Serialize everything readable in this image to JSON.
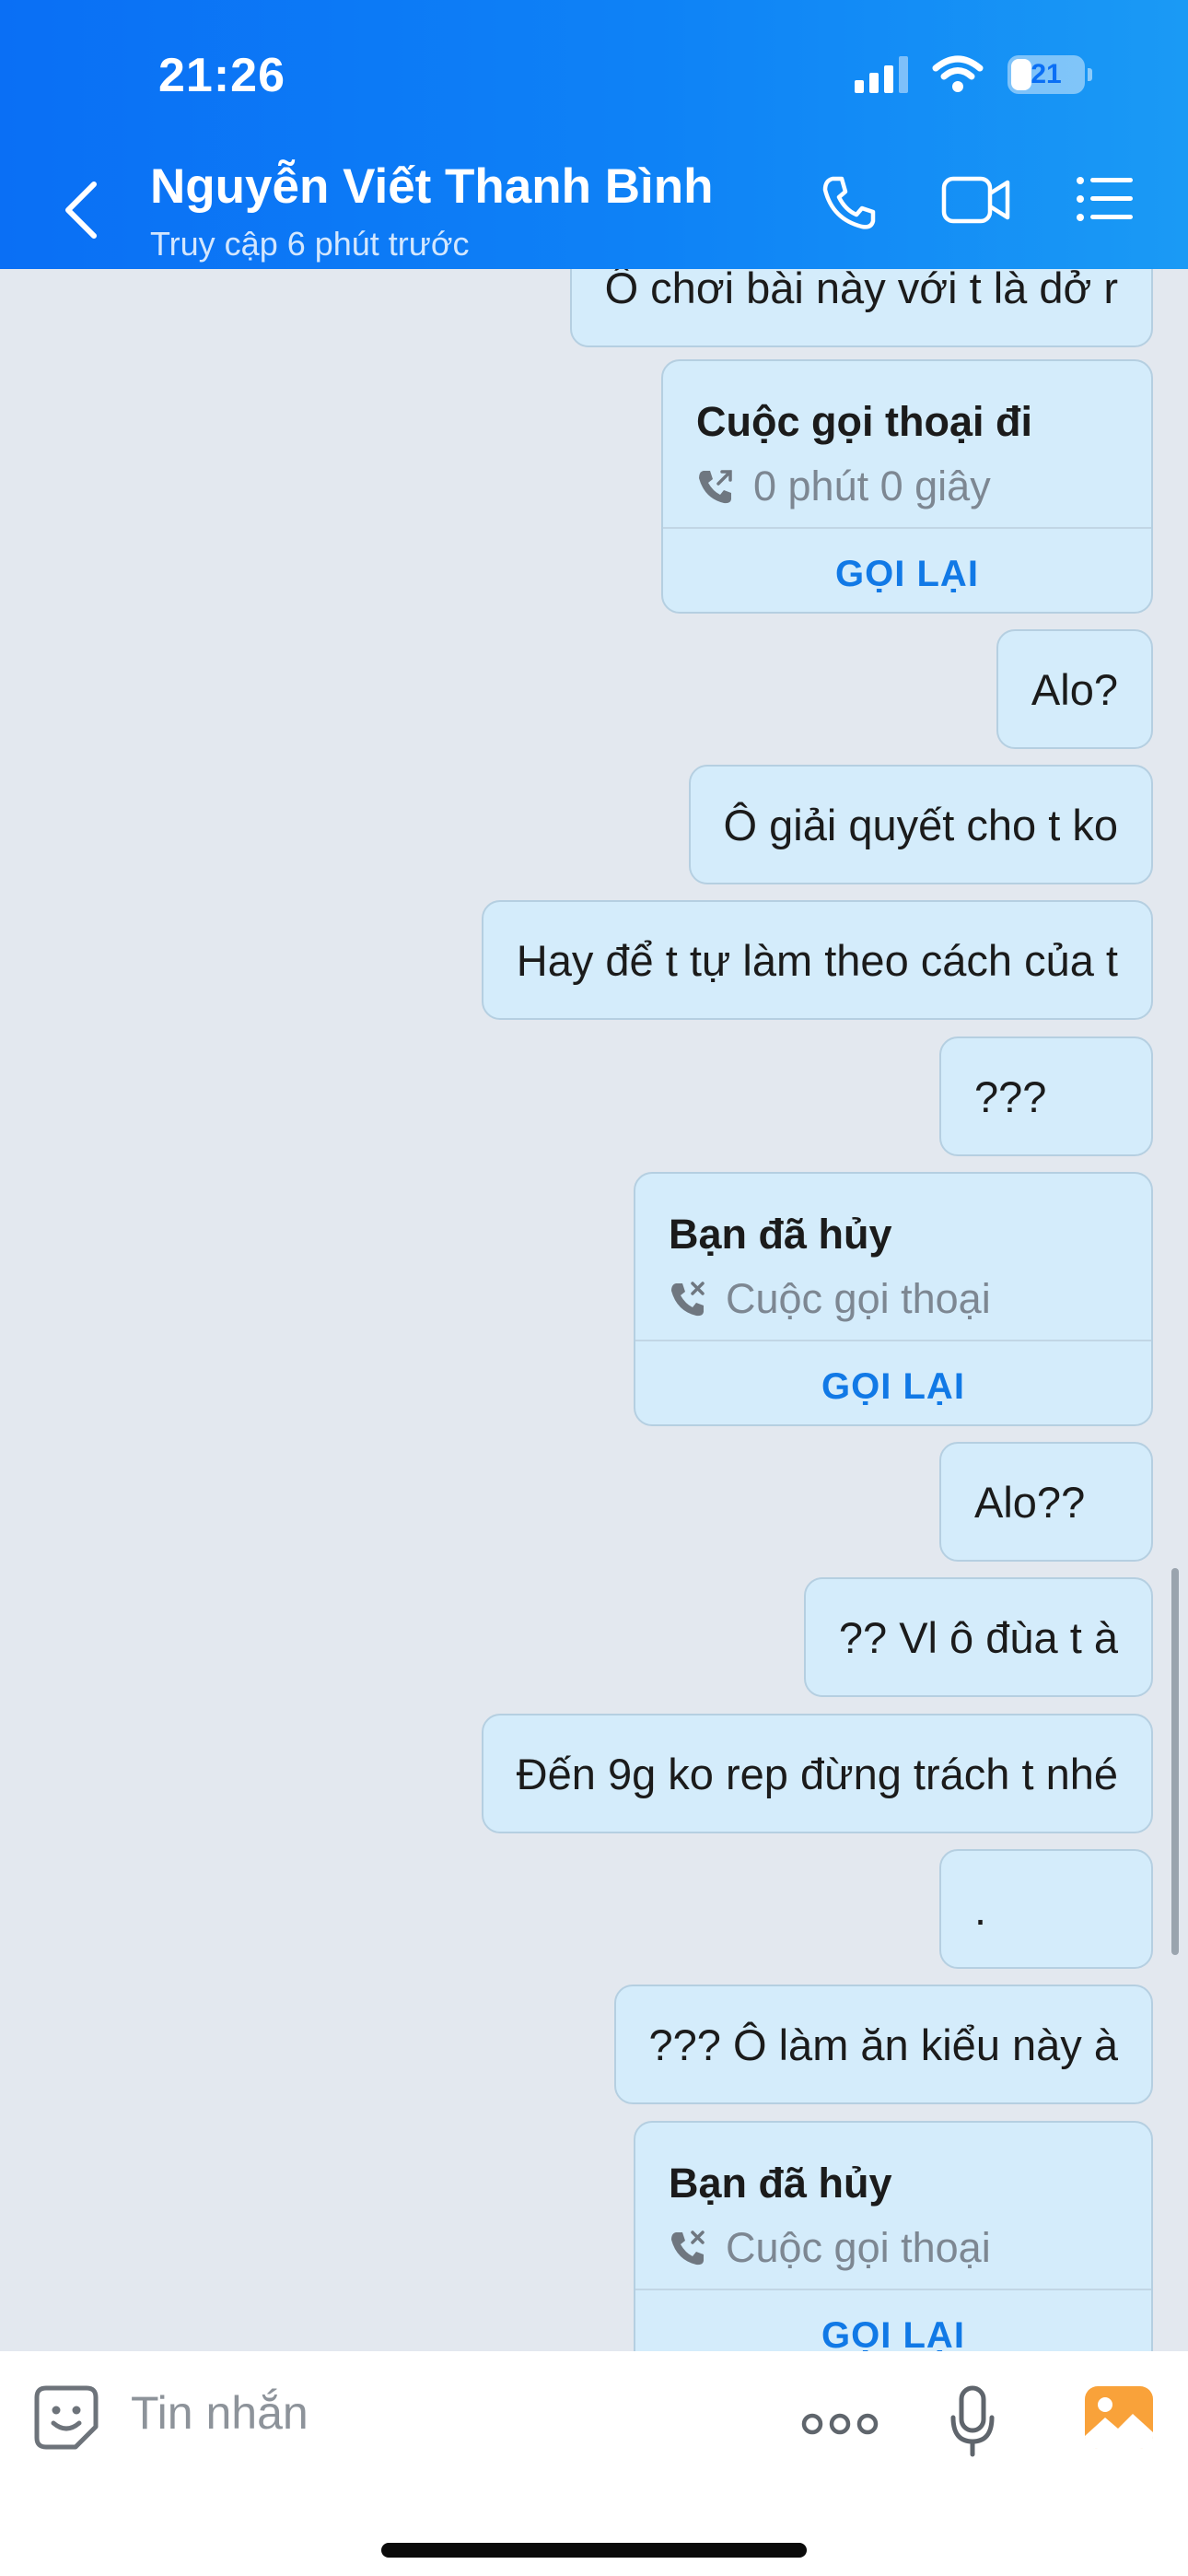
{
  "status_bar": {
    "time": "21:26",
    "battery": "21"
  },
  "header": {
    "contact_name": "Nguyễn Viết Thanh Bình",
    "contact_status": "Truy cập 6 phút trước",
    "icons": [
      "back-icon",
      "phone-icon",
      "video-call-icon",
      "menu-list-icon"
    ]
  },
  "messages": [
    {
      "type": "text",
      "text": "Ô chơi bài này với t là dở r"
    },
    {
      "type": "call",
      "title": "Cuộc gọi thoại đi",
      "subtitle": "0 phút 0 giây",
      "action": "GỌI LẠI",
      "icon": "outgoing-call-icon"
    },
    {
      "type": "text",
      "text": "Alo?"
    },
    {
      "type": "text",
      "text": "Ô giải quyết cho t ko"
    },
    {
      "type": "text",
      "text": "Hay để t tự làm theo cách của t"
    },
    {
      "type": "text",
      "text": "???"
    },
    {
      "type": "call",
      "title": "Bạn đã hủy",
      "subtitle": "Cuộc gọi thoại",
      "action": "GỌI LẠI",
      "icon": "cancelled-call-icon"
    },
    {
      "type": "text",
      "text": "Alo??"
    },
    {
      "type": "text",
      "text": "?? Vl ô đùa t à"
    },
    {
      "type": "text",
      "text": "Đến 9g ko rep đừng trách t nhé"
    },
    {
      "type": "text",
      "text": "."
    },
    {
      "type": "text",
      "text": "??? Ô làm ăn kiểu này à"
    },
    {
      "type": "call",
      "title": "Bạn đã hủy",
      "subtitle": "Cuộc gọi thoại",
      "action": "GỌI LẠI",
      "icon": "cancelled-call-icon"
    }
  ],
  "input_bar": {
    "placeholder": "Tin nhắn",
    "icons": [
      "sticker-icon",
      "more-icon",
      "microphone-icon",
      "image-gallery-icon"
    ]
  },
  "colors": {
    "header_start": "#0a6ff5",
    "header_end": "#1a9af5",
    "bubble": "#d4ecfb",
    "chat_background": "#e3e8ef",
    "accent": "#1179e6",
    "gallery_icon": "#f9a23a"
  }
}
